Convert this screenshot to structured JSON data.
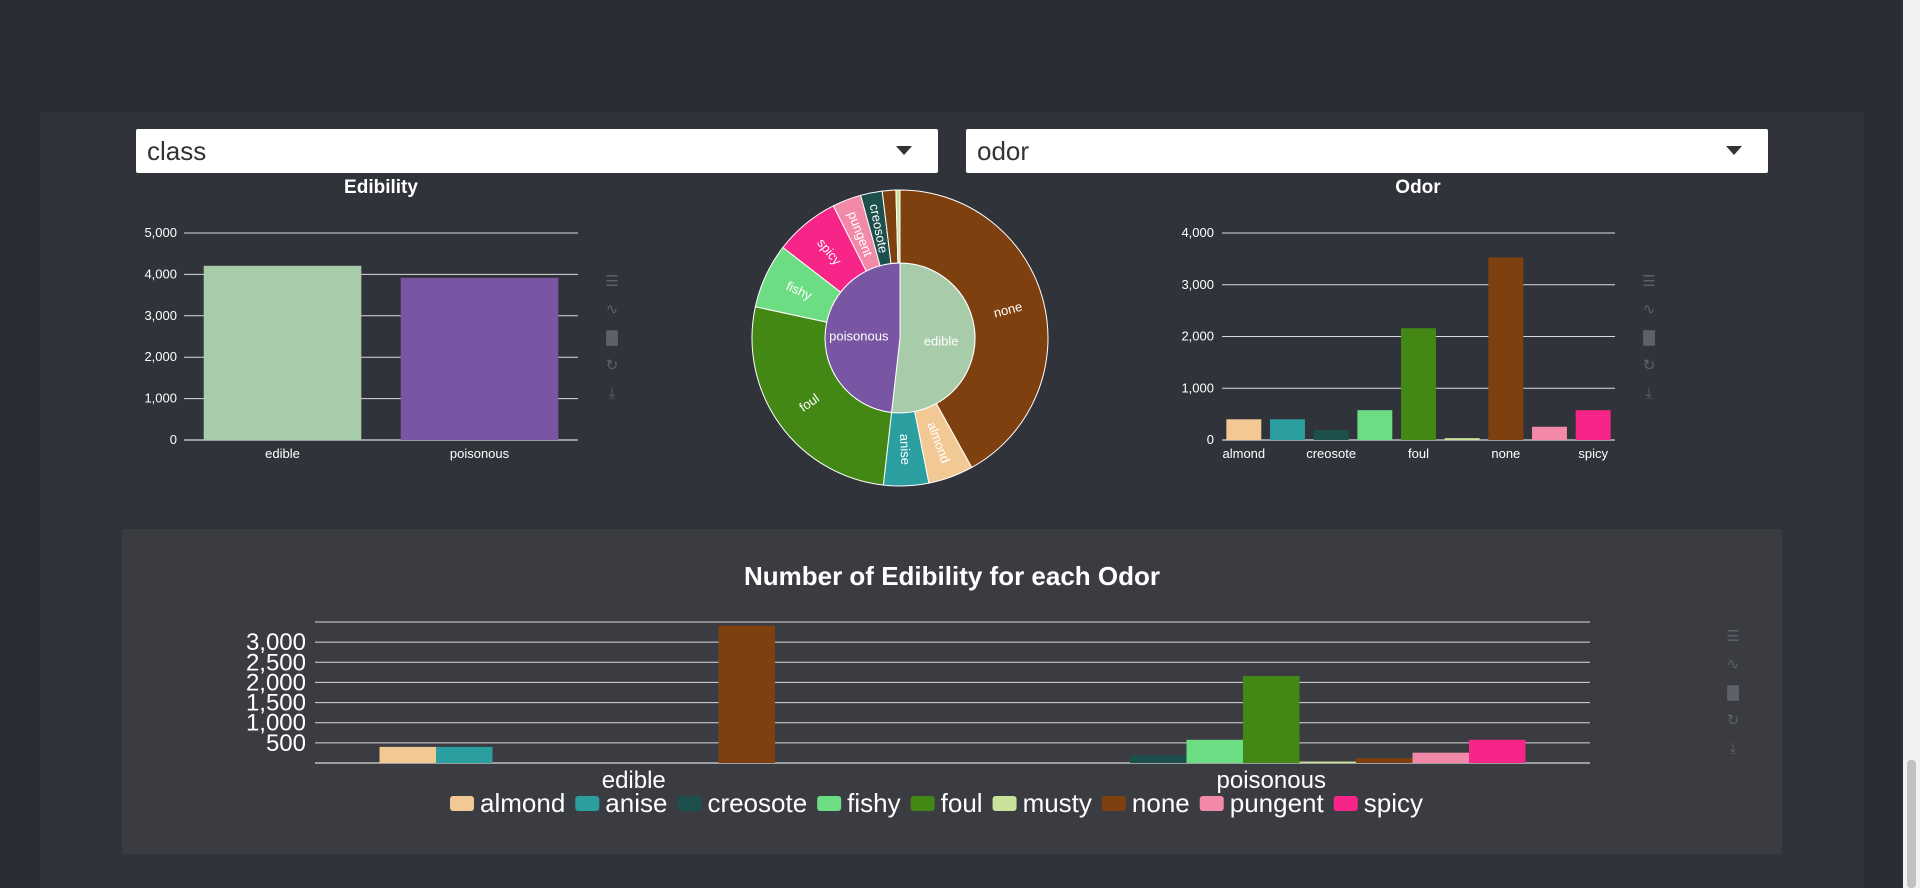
{
  "dropdowns": {
    "left": {
      "value": "class"
    },
    "right": {
      "value": "odor"
    }
  },
  "colors": {
    "almond": "#f2c994",
    "anise": "#2b9ea0",
    "creosote": "#1d4f4d",
    "fishy": "#6ddd83",
    "foul": "#438815",
    "musty": "#c8e29a",
    "none": "#7f4010",
    "pungent": "#f389a8",
    "spicy": "#f62587",
    "edible": "#a8ccaa",
    "poisonous": "#7856a3"
  },
  "chart_data": [
    {
      "id": "edibility",
      "type": "bar",
      "title": "Edibility",
      "categories": [
        "edible",
        "poisonous"
      ],
      "values": [
        4208,
        3916
      ],
      "ylim": [
        0,
        5000
      ],
      "yticks": [
        "0",
        "1,000",
        "2,000",
        "3,000",
        "4,000",
        "5,000"
      ],
      "grid": true
    },
    {
      "id": "sunburst",
      "type": "pie",
      "inner": [
        {
          "label": "edible",
          "value": 4208,
          "color_key": "edible"
        },
        {
          "label": "poisonous",
          "value": 3916,
          "color_key": "poisonous"
        }
      ],
      "outer": [
        {
          "parent": "edible",
          "label": "none",
          "value": 3408,
          "color_key": "none"
        },
        {
          "parent": "edible",
          "label": "almond",
          "value": 400,
          "color_key": "almond"
        },
        {
          "parent": "edible",
          "label": "anise",
          "value": 400,
          "color_key": "anise"
        },
        {
          "parent": "poisonous",
          "label": "foul",
          "value": 2160,
          "color_key": "foul"
        },
        {
          "parent": "poisonous",
          "label": "fishy",
          "value": 576,
          "color_key": "fishy"
        },
        {
          "parent": "poisonous",
          "label": "spicy",
          "value": 576,
          "color_key": "spicy"
        },
        {
          "parent": "poisonous",
          "label": "pungent",
          "value": 256,
          "color_key": "pungent"
        },
        {
          "parent": "poisonous",
          "label": "creosote",
          "value": 192,
          "color_key": "creosote"
        },
        {
          "parent": "poisonous",
          "label": "none",
          "value": 120,
          "color_key": "none"
        },
        {
          "parent": "poisonous",
          "label": "musty",
          "value": 36,
          "color_key": "musty"
        }
      ]
    },
    {
      "id": "odor",
      "type": "bar",
      "title": "Odor",
      "categories": [
        "almond",
        "anise",
        "creosote",
        "fishy",
        "foul",
        "musty",
        "none",
        "pungent",
        "spicy"
      ],
      "values": [
        400,
        400,
        192,
        576,
        2160,
        36,
        3528,
        256,
        576
      ],
      "tick_labels": [
        "almond",
        "",
        "creosote",
        "",
        "foul",
        "",
        "none",
        "",
        "spicy"
      ],
      "ylim": [
        0,
        4000
      ],
      "yticks": [
        "0",
        "1,000",
        "2,000",
        "3,000",
        "4,000"
      ],
      "grid": true
    },
    {
      "id": "grouped",
      "type": "bar",
      "title": "Number of Edibility for each Odor",
      "categories": [
        "edible",
        "poisonous"
      ],
      "series": [
        {
          "name": "almond",
          "values": [
            400,
            0
          ]
        },
        {
          "name": "anise",
          "values": [
            400,
            0
          ]
        },
        {
          "name": "creosote",
          "values": [
            0,
            192
          ]
        },
        {
          "name": "fishy",
          "values": [
            0,
            576
          ]
        },
        {
          "name": "foul",
          "values": [
            0,
            2160
          ]
        },
        {
          "name": "musty",
          "values": [
            0,
            36
          ]
        },
        {
          "name": "none",
          "values": [
            3408,
            120
          ]
        },
        {
          "name": "pungent",
          "values": [
            0,
            256
          ]
        },
        {
          "name": "spicy",
          "values": [
            0,
            576
          ]
        }
      ],
      "ylim": [
        0,
        3500
      ],
      "yticks": [
        "500",
        "1,000",
        "1,500",
        "2,000",
        "2,500",
        "3,000"
      ],
      "legend": "bottom",
      "grid": true
    }
  ],
  "toolbox_icons": [
    "data-view-icon",
    "line-chart-icon",
    "bar-chart-icon",
    "restore-icon",
    "save-image-icon"
  ]
}
